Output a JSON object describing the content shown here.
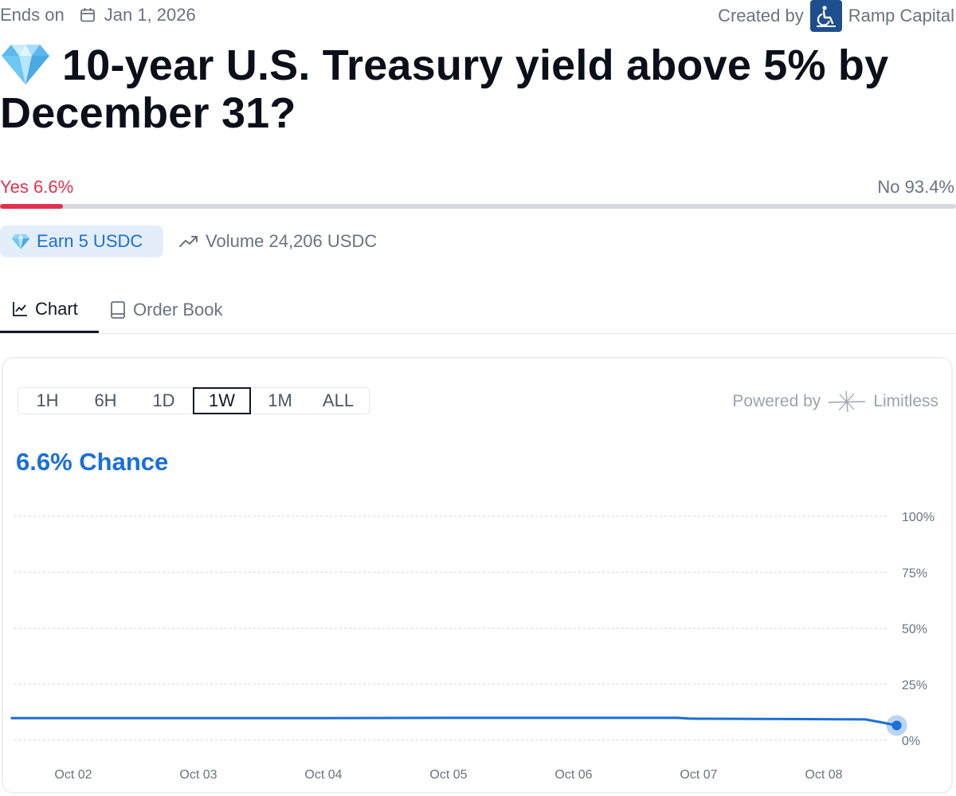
{
  "meta": {
    "ends_label": "Ends on",
    "ends_date": "Jan 1, 2026",
    "created_label": "Created by",
    "creator": "Ramp Capital"
  },
  "market": {
    "emoji_icon": "gem-icon",
    "title": "10-year U.S. Treasury yield above 5% by December 31?",
    "yes_label": "Yes 6.6%",
    "no_label": "No 93.4%",
    "yes_fraction": 0.066,
    "yes_color": "#e0324f"
  },
  "badges": {
    "earn_label": "Earn 5 USDC",
    "volume_label": "Volume 24,206 USDC"
  },
  "tabs": [
    {
      "label": "Chart",
      "active": true,
      "icon": "line-chart-icon"
    },
    {
      "label": "Order Book",
      "active": false,
      "icon": "book-icon"
    }
  ],
  "chart_panel": {
    "ranges": [
      "1H",
      "6H",
      "1D",
      "1W",
      "1M",
      "ALL"
    ],
    "selected_range": "1W",
    "powered_by": "Powered by",
    "provider": "Limitless",
    "chance_label": "6.6% Chance",
    "accent": "#1a6fd8"
  },
  "chart_data": {
    "type": "line",
    "title": "",
    "xlabel": "",
    "ylabel": "",
    "ylim": [
      0,
      100
    ],
    "y_ticks": [
      "0%",
      "25%",
      "50%",
      "75%",
      "100%"
    ],
    "y_tick_values": [
      0,
      25,
      50,
      75,
      100
    ],
    "x_ticks": [
      "Oct 02",
      "Oct 03",
      "Oct 04",
      "Oct 05",
      "Oct 06",
      "Oct 07",
      "Oct 08"
    ],
    "grid": true,
    "series": [
      {
        "color": "#1a6fd8",
        "points": [
          {
            "x": "Oct 01 12:00",
            "y": 9.9
          },
          {
            "x": "Oct 02",
            "y": 9.9
          },
          {
            "x": "Oct 03",
            "y": 9.9
          },
          {
            "x": "Oct 04",
            "y": 9.9
          },
          {
            "x": "Oct 05",
            "y": 10.0
          },
          {
            "x": "Oct 06",
            "y": 10.0
          },
          {
            "x": "Oct 06 20:00",
            "y": 10.0
          },
          {
            "x": "Oct 06 22:00",
            "y": 9.7
          },
          {
            "x": "Oct 07",
            "y": 9.6
          },
          {
            "x": "Oct 08",
            "y": 9.4
          },
          {
            "x": "Oct 08 08:00",
            "y": 9.3
          },
          {
            "x": "Oct 08 11:00",
            "y": 8.0
          },
          {
            "x": "Oct 08 14:00",
            "y": 6.6
          }
        ]
      }
    ]
  }
}
